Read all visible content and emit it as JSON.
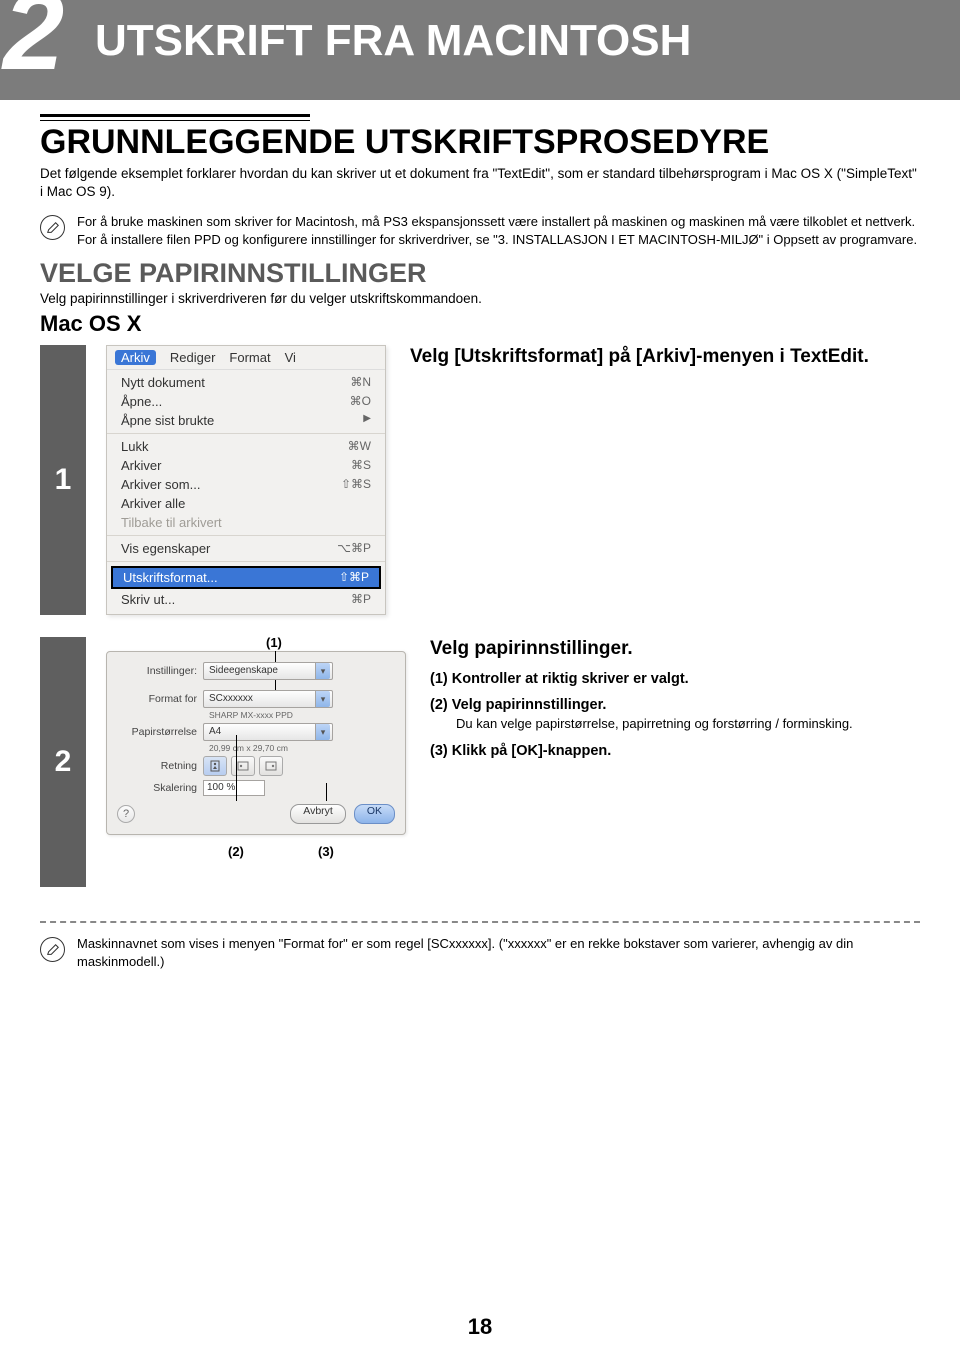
{
  "chapter": {
    "num": "2",
    "title": "UTSKRIFT FRA MACINTOSH"
  },
  "section": {
    "title": "GRUNNLEGGENDE UTSKRIFTSPROSEDYRE",
    "intro": "Det følgende eksemplet forklarer hvordan du kan skriver ut et dokument fra \"TextEdit\", som er standard tilbehørsprogram i Mac OS X (\"SimpleText\" i Mac OS 9)."
  },
  "note1": "For å bruke maskinen som skriver for Macintosh, må PS3 ekspansjonssett være installert på maskinen og maskinen må være tilkoblet et nettverk. For å installere filen PPD og konfigurere innstillinger for skriverdriver, se \"3. INSTALLASJON I ET MACINTOSH-MILJØ\" i Oppsett av programvare.",
  "section2": {
    "title": "VELGE PAPIRINNSTILLINGER",
    "sub": "Velg papirinnstillinger i skriverdriveren før du velger utskriftskommandoen.",
    "h3": "Mac OS X"
  },
  "menu": {
    "bar": [
      "Arkiv",
      "Rediger",
      "Format",
      "Vi"
    ],
    "g1": [
      {
        "l": "Nytt dokument",
        "s": "⌘N"
      },
      {
        "l": "Åpne...",
        "s": "⌘O"
      },
      {
        "l": "Åpne sist brukte",
        "s": "",
        "arrow": true
      }
    ],
    "g2": [
      {
        "l": "Lukk",
        "s": "⌘W"
      },
      {
        "l": "Arkiver",
        "s": "⌘S"
      },
      {
        "l": "Arkiver som...",
        "s": "⇧⌘S"
      },
      {
        "l": "Arkiver alle",
        "s": ""
      },
      {
        "l": "Tilbake til arkivert",
        "s": "",
        "dim": true
      }
    ],
    "g3": [
      {
        "l": "Vis egenskaper",
        "s": "⌥⌘P"
      }
    ],
    "g4": [
      {
        "l": "Utskriftsformat...",
        "s": "⇧⌘P",
        "hl": true
      },
      {
        "l": "Skriv ut...",
        "s": "⌘P"
      }
    ]
  },
  "step1": {
    "num": "1",
    "title": "Velg [Utskriftsformat] på [Arkiv]-menyen i TextEdit."
  },
  "step2": {
    "num": "2",
    "title": "Velg papirinnstillinger.",
    "items": [
      {
        "n": "(1)",
        "t": "Kontroller at riktig skriver er valgt."
      },
      {
        "n": "(2)",
        "t": "Velg papirinnstillinger.",
        "body": "Du kan velge papirstørrelse, papirretning og forstørring / forminsking."
      },
      {
        "n": "(3)",
        "t": "Klikk på [OK]-knappen."
      }
    ],
    "callouts": {
      "c1": "(1)",
      "c2": "(2)",
      "c3": "(3)"
    }
  },
  "dlg": {
    "lbl": {
      "inst": "Instillinger:",
      "format": "Format for",
      "paper": "Papirstørrelse",
      "orient": "Retning",
      "scale": "Skalering"
    },
    "val": {
      "inst": "Sideegenskape",
      "format": "SCxxxxxx",
      "formatNote": "SHARP MX-xxxx PPD",
      "paper": "A4",
      "paperNote": "20,99 cm x 29,70 cm",
      "scale": "100 %"
    },
    "btn": {
      "cancel": "Avbryt",
      "ok": "OK"
    },
    "q": "?"
  },
  "note2": "Maskinnavnet som vises i menyen \"Format for\" er som regel [SCxxxxxx]. (\"xxxxxx\" er en rekke bokstaver som varierer, avhengig av din maskinmodell.)",
  "page": "18"
}
